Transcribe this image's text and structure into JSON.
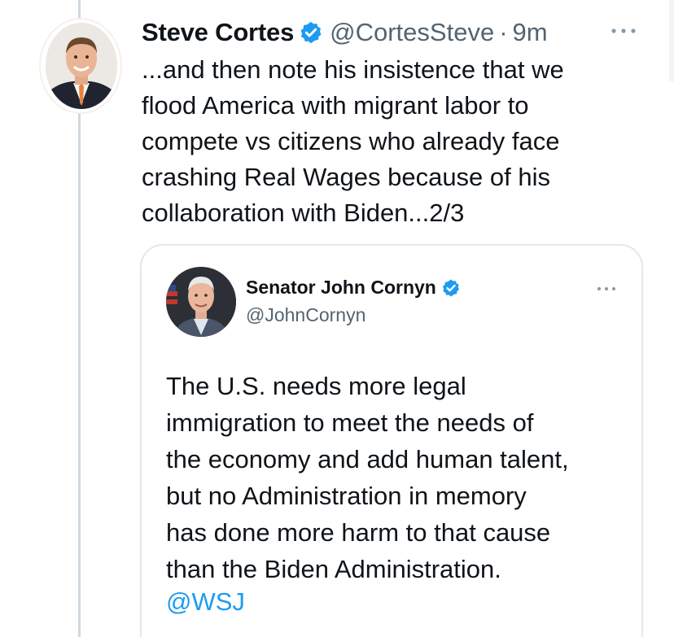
{
  "tweet": {
    "author_name": "Steve Cortes",
    "author_handle": "@CortesSteve",
    "separator": "·",
    "time": "9m",
    "text": "...and then note his insistence that we\nflood America with migrant labor to\ncompete vs citizens who already face\ncrashing Real Wages because of his\ncollaboration with Biden...2/3",
    "avatar_icon": "person-avatar",
    "verified_icon": "verified-badge-icon",
    "more_icon": "more-options-icon"
  },
  "quoted_tweet": {
    "author_name": "Senator John Cornyn",
    "author_handle": "@JohnCornyn",
    "text": "The U.S. needs more legal\nimmigration to meet the needs of\nthe economy and add human talent,\nbut no Administration in memory\nhas done more harm to that cause\nthan the Biden Administration.",
    "mention": "@WSJ",
    "avatar_icon": "person-avatar",
    "verified_icon": "verified-badge-icon",
    "more_icon": "more-options-icon"
  },
  "colors": {
    "verified_blue": "#1d9bf0",
    "link_blue": "#1d9bf0",
    "secondary_text": "#536471",
    "border": "#e1e8ed",
    "thread_line": "#cfd9de"
  }
}
